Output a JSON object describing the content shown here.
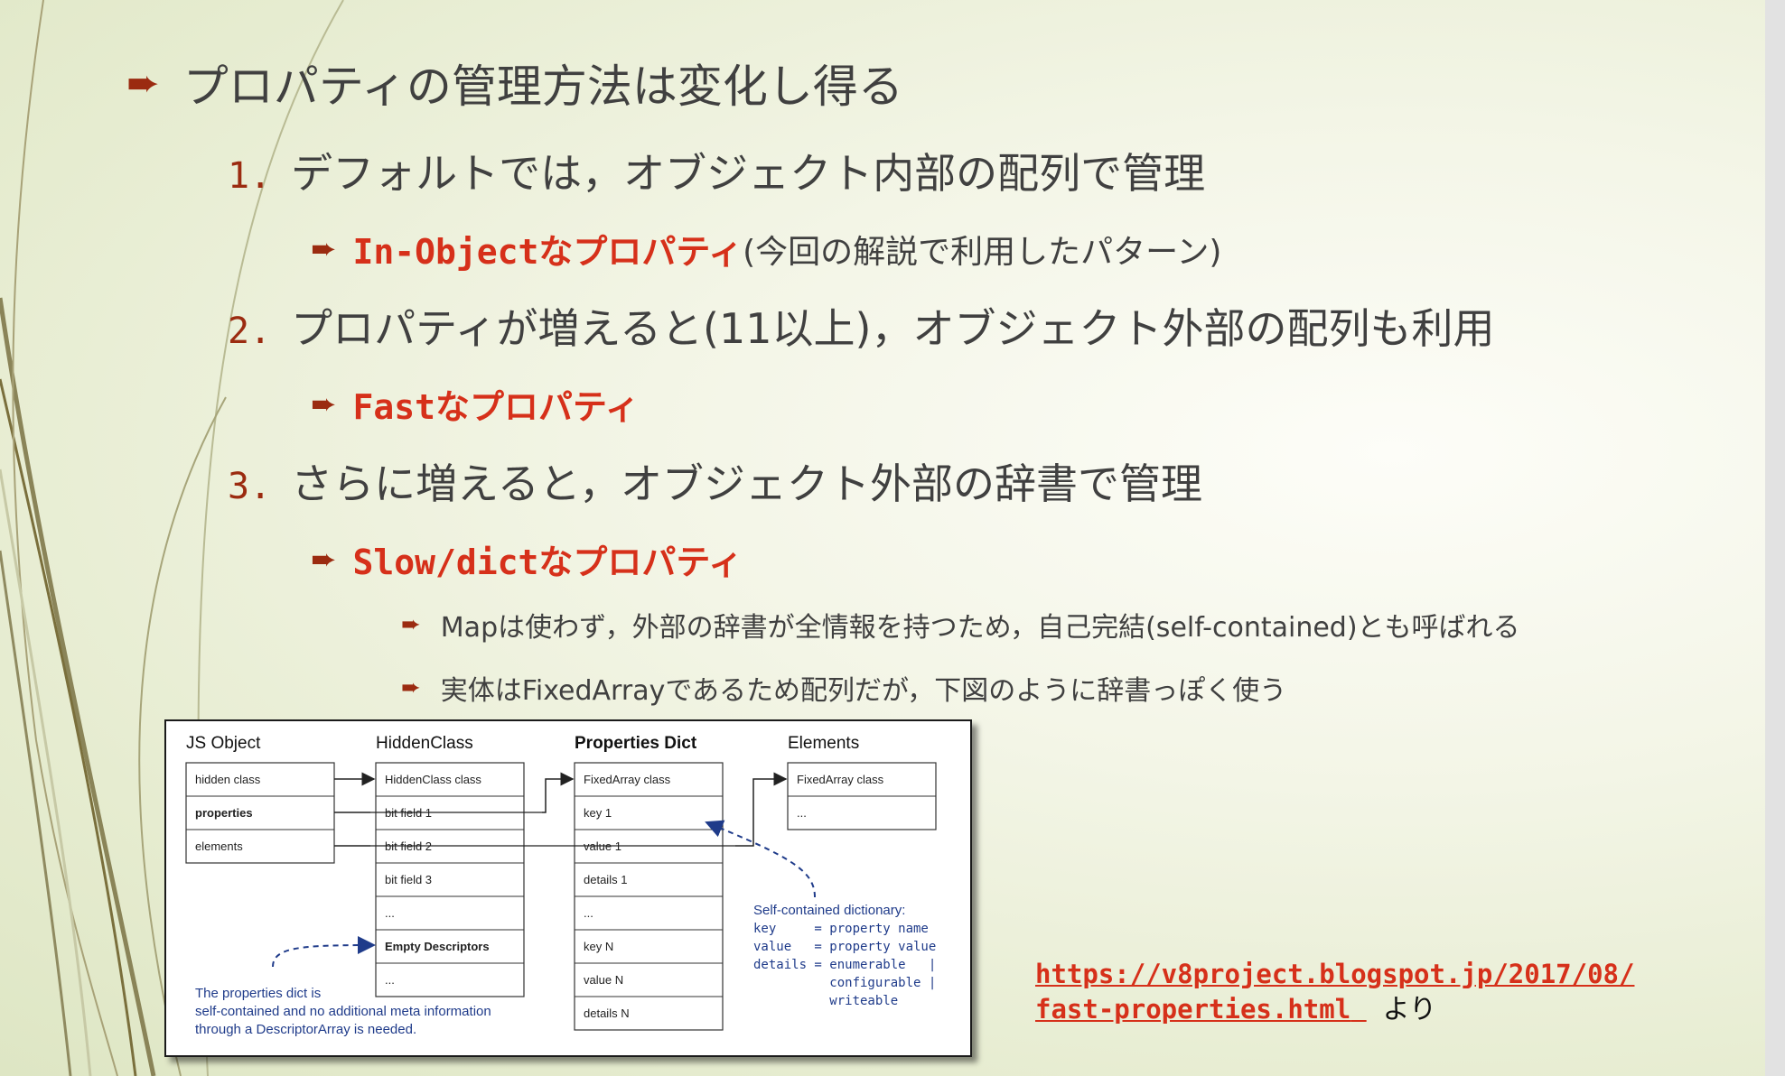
{
  "bullets": {
    "main": "プロパティの管理方法は変化し得る",
    "item1": {
      "number": "1.",
      "text": "デフォルトでは，オブジェクト内部の配列で管理"
    },
    "item1_sub": {
      "highlight": "In-Objectなプロパティ",
      "note": "(今回の解説で利用したパターン)"
    },
    "item2": {
      "number": "2.",
      "text": "プロパティが増えると(11以上)，オブジェクト外部の配列も利用"
    },
    "item2_sub": {
      "highlight": "Fastなプロパティ"
    },
    "item3": {
      "number": "3.",
      "text": "さらに増えると，オブジェクト外部の辞書で管理"
    },
    "item3_sub": {
      "highlight": "Slow/dictなプロパティ"
    },
    "item3_details": [
      "Mapは使わず，外部の辞書が全情報を持つため，自己完結(self-contained)とも呼ばれる",
      "実体はFixedArrayであるため配列だが，下図のように辞書っぽく使う"
    ]
  },
  "figure": {
    "headers": [
      "JS Object",
      "HiddenClass",
      "Properties Dict",
      "Elements"
    ],
    "js_object": [
      "hidden class",
      "properties",
      "elements"
    ],
    "hidden_class": [
      "HiddenClass class",
      "bit field 1",
      "bit field 2",
      "bit field 3",
      "...",
      "Empty Descriptors",
      "..."
    ],
    "properties_dict": [
      "FixedArray class",
      "key 1",
      "value 1",
      "details 1",
      "...",
      "key N",
      "value N",
      "details N"
    ],
    "elements": [
      "FixedArray class",
      "..."
    ],
    "note_left": [
      "The properties dict is",
      "self-contained and no additional meta information",
      "through a DescriptorArray is needed."
    ],
    "note_right_title": "Self-contained dictionary:",
    "note_right_lines": [
      "key     = property name",
      "value   = property value",
      "details = enumerable   |",
      "          configurable |",
      "          writeable"
    ]
  },
  "source": {
    "url_line1": "https://v8project.blogspot.jp/2017/08/",
    "url_line2": "fast-properties.html",
    "suffix": "より"
  },
  "colors": {
    "accent_red": "#d6301a",
    "arrow_brown": "#9b2b10",
    "text": "#404040",
    "figure_note_blue": "#1f3b8a"
  }
}
